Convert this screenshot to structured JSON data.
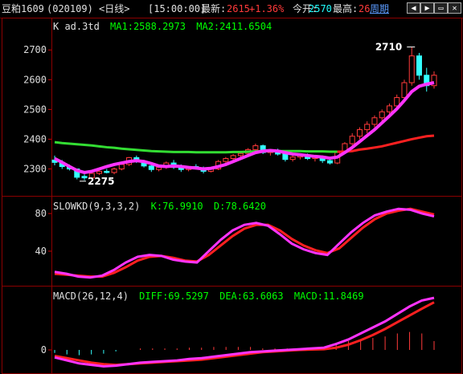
{
  "topbar": {
    "symbol": "豆粕1609",
    "code": "(020109)",
    "period": "<日线>",
    "time": "[15:00:00]",
    "last_label": "最新:",
    "last": "2615",
    "change_pct": "+1.36%",
    "open_label": "今开:",
    "open": "2570",
    "high_label": "最高:",
    "high": "26",
    "period_btn": "周期",
    "nav_icons": [
      "prev-icon",
      "next-icon",
      "restore-icon",
      "close-icon"
    ]
  },
  "chart_data": [
    {
      "type": "candlestick",
      "title": "K  ad.3td",
      "legend": [
        {
          "name": "MA1",
          "value": "2588.2973",
          "color": "#00ff00"
        },
        {
          "name": "MA2",
          "value": "2411.6504",
          "color": "#00ff00"
        }
      ],
      "ylim": [
        2215,
        2760
      ],
      "y_ticks": [
        2300,
        2400,
        2500,
        2600,
        2700
      ],
      "annotations": [
        {
          "text": "2710",
          "at": 2710
        },
        {
          "text": "2275",
          "at": 2275
        }
      ],
      "candles": [
        [
          2330,
          2345,
          2312,
          2322
        ],
        [
          2322,
          2330,
          2300,
          2308
        ],
        [
          2308,
          2315,
          2295,
          2300
        ],
        [
          2300,
          2292,
          2265,
          2272
        ],
        [
          2275,
          2282,
          2262,
          2270
        ],
        [
          2270,
          2290,
          2266,
          2285
        ],
        [
          2285,
          2300,
          2280,
          2292
        ],
        [
          2292,
          2300,
          2285,
          2288
        ],
        [
          2288,
          2305,
          2282,
          2300
        ],
        [
          2300,
          2320,
          2295,
          2315
        ],
        [
          2315,
          2340,
          2310,
          2338
        ],
        [
          2338,
          2345,
          2320,
          2325
        ],
        [
          2325,
          2330,
          2305,
          2310
        ],
        [
          2310,
          2315,
          2290,
          2298
        ],
        [
          2298,
          2310,
          2292,
          2305
        ],
        [
          2305,
          2325,
          2300,
          2320
        ],
        [
          2320,
          2330,
          2300,
          2305
        ],
        [
          2305,
          2315,
          2290,
          2298
        ],
        [
          2298,
          2310,
          2292,
          2308
        ],
        [
          2308,
          2316,
          2298,
          2302
        ],
        [
          2302,
          2308,
          2285,
          2292
        ],
        [
          2292,
          2305,
          2288,
          2300
        ],
        [
          2300,
          2330,
          2296,
          2325
        ],
        [
          2325,
          2340,
          2318,
          2335
        ],
        [
          2335,
          2350,
          2325,
          2345
        ],
        [
          2345,
          2360,
          2335,
          2352
        ],
        [
          2352,
          2370,
          2345,
          2365
        ],
        [
          2365,
          2385,
          2355,
          2378
        ],
        [
          2378,
          2382,
          2350,
          2355
        ],
        [
          2355,
          2365,
          2345,
          2360
        ],
        [
          2360,
          2368,
          2345,
          2350
        ],
        [
          2350,
          2355,
          2325,
          2332
        ],
        [
          2332,
          2345,
          2325,
          2340
        ],
        [
          2340,
          2350,
          2332,
          2345
        ],
        [
          2345,
          2352,
          2330,
          2335
        ],
        [
          2335,
          2345,
          2325,
          2340
        ],
        [
          2340,
          2345,
          2320,
          2328
        ],
        [
          2328,
          2338,
          2315,
          2320
        ],
        [
          2320,
          2360,
          2316,
          2355
        ],
        [
          2355,
          2390,
          2350,
          2385
        ],
        [
          2385,
          2420,
          2375,
          2410
        ],
        [
          2410,
          2440,
          2400,
          2432
        ],
        [
          2432,
          2460,
          2420,
          2450
        ],
        [
          2450,
          2480,
          2440,
          2472
        ],
        [
          2472,
          2500,
          2460,
          2492
        ],
        [
          2492,
          2520,
          2480,
          2512
        ],
        [
          2512,
          2550,
          2500,
          2540
        ],
        [
          2540,
          2600,
          2530,
          2590
        ],
        [
          2590,
          2710,
          2580,
          2680
        ],
        [
          2680,
          2690,
          2600,
          2615
        ],
        [
          2615,
          2640,
          2560,
          2580
        ],
        [
          2580,
          2628,
          2570,
          2615
        ]
      ],
      "ma1": [
        2335,
        2322,
        2308,
        2295,
        2288,
        2292,
        2300,
        2308,
        2315,
        2320,
        2325,
        2328,
        2325,
        2318,
        2310,
        2308,
        2310,
        2308,
        2305,
        2303,
        2300,
        2302,
        2308,
        2315,
        2325,
        2335,
        2345,
        2355,
        2360,
        2362,
        2360,
        2355,
        2350,
        2348,
        2345,
        2342,
        2340,
        2336,
        2340,
        2355,
        2372,
        2392,
        2412,
        2432,
        2455,
        2478,
        2502,
        2530,
        2560,
        2578,
        2585,
        2590
      ],
      "ma2": [
        2390,
        2387,
        2385,
        2383,
        2381,
        2379,
        2376,
        2373,
        2371,
        2368,
        2366,
        2364,
        2362,
        2360,
        2359,
        2358,
        2357,
        2357,
        2357,
        2356,
        2356,
        2356,
        2356,
        2356,
        2357,
        2357,
        2358,
        2359,
        2360,
        2360,
        2360,
        2360,
        2360,
        2360,
        2359,
        2359,
        2359,
        2358,
        2358,
        2358,
        2360,
        2365,
        2368,
        2372,
        2376,
        2382,
        2388,
        2394,
        2400,
        2405,
        2410,
        2412
      ]
    },
    {
      "type": "line",
      "title": "SLOWKD(9,3,3,2)",
      "legend": [
        {
          "name": "K",
          "value": "76.9910",
          "color": "#00ff00"
        },
        {
          "name": "D",
          "value": "78.6420",
          "color": "#00ff00"
        }
      ],
      "ylim": [
        5,
        92
      ],
      "y_ticks": [
        40,
        80
      ],
      "k": [
        18,
        16,
        13,
        12,
        14,
        20,
        28,
        34,
        36,
        35,
        31,
        29,
        28,
        40,
        52,
        62,
        68,
        70,
        67,
        58,
        48,
        42,
        38,
        36,
        48,
        60,
        70,
        78,
        82,
        85,
        84,
        80,
        77
      ],
      "d": [
        16,
        15,
        14,
        13,
        13,
        17,
        23,
        30,
        34,
        35,
        33,
        30,
        29,
        36,
        46,
        56,
        64,
        68,
        68,
        62,
        53,
        46,
        41,
        38,
        43,
        54,
        65,
        74,
        80,
        83,
        85,
        82,
        79
      ]
    },
    {
      "type": "line+bar",
      "title": "MACD(26,12,4)",
      "legend": [
        {
          "name": "DIFF",
          "value": "69.5297",
          "color": "#00ff00"
        },
        {
          "name": "DEA",
          "value": "63.6063",
          "color": "#00ff00"
        },
        {
          "name": "MACD",
          "value": "11.8469",
          "color": "#00ff00"
        }
      ],
      "ylim": [
        -30,
        75
      ],
      "y_ticks": [
        0
      ],
      "diff": [
        -10,
        -14,
        -18,
        -20,
        -22,
        -21,
        -19,
        -17,
        -16,
        -15,
        -14,
        -12,
        -11,
        -9,
        -7,
        -5,
        -3,
        -2,
        -1,
        0,
        1,
        2,
        3,
        8,
        14,
        22,
        30,
        38,
        48,
        58,
        66,
        69.5
      ],
      "dea": [
        -8,
        -11,
        -14,
        -17,
        -19,
        -20,
        -19,
        -18,
        -17,
        -16,
        -15,
        -14,
        -13,
        -11,
        -9,
        -7,
        -5,
        -3,
        -2,
        -1,
        0,
        0.5,
        1,
        3,
        7,
        13,
        20,
        28,
        37,
        46,
        55,
        63.6
      ],
      "macd": [
        -4,
        -6,
        -7,
        -6,
        -5,
        -2,
        0,
        2,
        2,
        2,
        2,
        3,
        3,
        4,
        4,
        4,
        4,
        2,
        2,
        2,
        2,
        2,
        3,
        7,
        12,
        14,
        16,
        18,
        22,
        24,
        22,
        11.8
      ]
    }
  ]
}
